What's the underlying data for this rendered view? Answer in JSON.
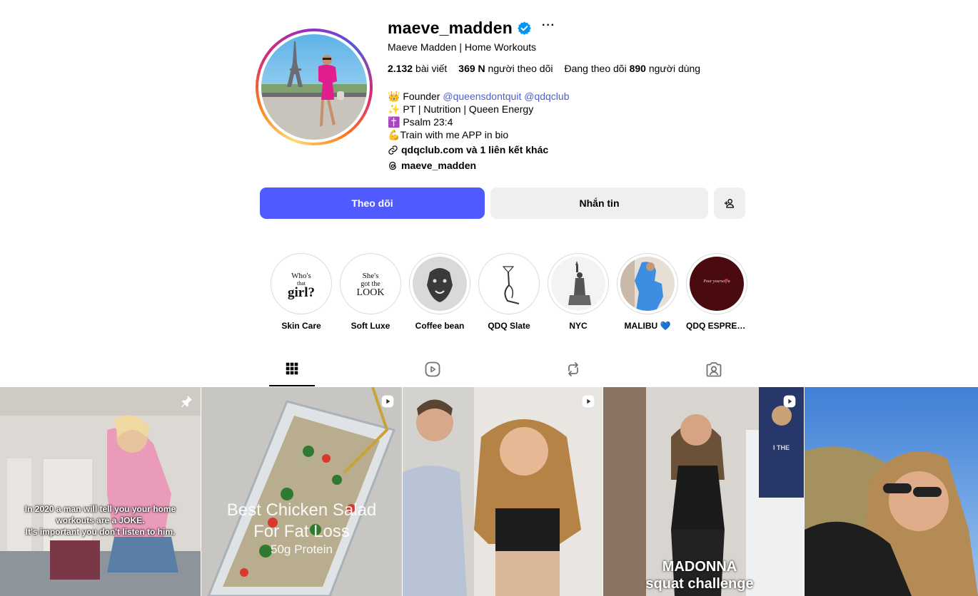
{
  "profile": {
    "username": "maeve_madden",
    "more_label": "···",
    "full_name": "Maeve Madden | Home Workouts",
    "stats": {
      "posts_value": "2.132",
      "posts_label": "bài viết",
      "followers_value": "369 N",
      "followers_label": "người theo dõi",
      "following_prefix": "Đang theo dõi",
      "following_value": "890",
      "following_suffix": "người dùng"
    },
    "bio": {
      "line1_emoji": "👑",
      "line1_text": "Founder",
      "line1_mention1": "@queensdontquit",
      "line1_mention2": "@qdqclub",
      "line2_emoji": "✨",
      "line2_text": "PT | Nutrition | Queen Energy",
      "line3_emoji": "✝️",
      "line3_text": "Psalm 23:4",
      "line4_emoji": "💪",
      "line4_text": "Train with me APP in bio"
    },
    "link_text": "qdqclub.com và 1 liên kết khác",
    "threads_handle": "maeve_madden"
  },
  "actions": {
    "follow_label": "Theo dõi",
    "message_label": "Nhắn tin"
  },
  "highlights": [
    {
      "label": "Skin Care",
      "art_text": "Who's that girl?"
    },
    {
      "label": "Soft Luxe",
      "art_text": "She's got the LOOK"
    },
    {
      "label": "Coffee bean"
    },
    {
      "label": "QDQ Slate"
    },
    {
      "label": "NYC"
    },
    {
      "label": "MALIBU 💙"
    },
    {
      "label": "QDQ ESPRES...",
      "art_text": "Pour yourself a"
    }
  ],
  "tabs": [
    {
      "icon": "grid-icon",
      "active": true
    },
    {
      "icon": "reels-icon",
      "active": false
    },
    {
      "icon": "reposts-icon",
      "active": false
    },
    {
      "icon": "tagged-icon",
      "active": false
    }
  ],
  "posts": [
    {
      "badge": "pin-icon",
      "caption_lines": [
        "In 2020 a man will tell you your home",
        "workouts are a JOKE.",
        "It's important you don't listen to him."
      ]
    },
    {
      "badge": "reel-icon",
      "caption_lines": [
        "Best Chicken Salad",
        "For Fat Loss",
        "50g Protein"
      ]
    },
    {
      "badge": "reel-icon",
      "caption_lines": []
    },
    {
      "badge": "reel-icon",
      "caption_lines": [
        "MADONNA",
        "squat challenge"
      ],
      "inset_text": "I THE"
    },
    {
      "badge": "",
      "caption_lines": []
    }
  ],
  "colors": {
    "follow_button": "#4f5bff",
    "secondary_button": "#efefef",
    "mention": "#4a5fd0",
    "verified": "#0095f6"
  }
}
